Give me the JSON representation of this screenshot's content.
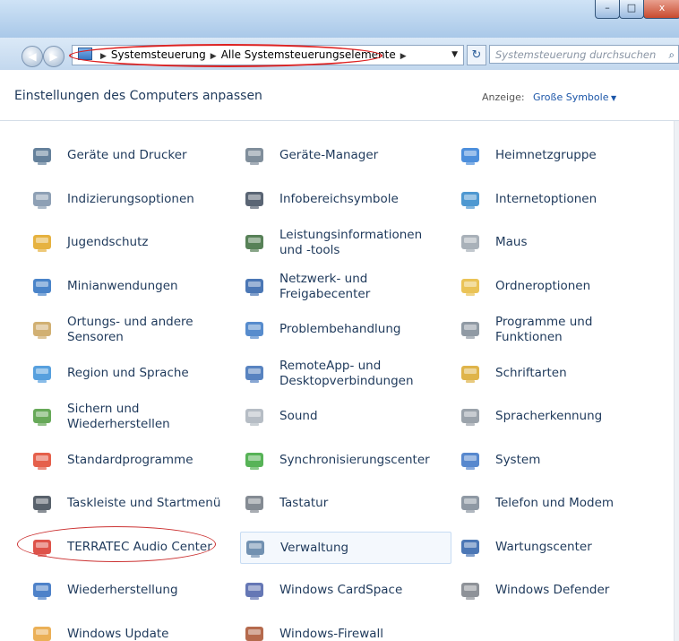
{
  "window": {
    "controls": [
      "–",
      "□",
      "x"
    ]
  },
  "navigation": {
    "back_glyph": "◀",
    "forward_glyph": "▶",
    "breadcrumb": [
      "Systemsteuerung",
      "Alle Systemsteuerungselemente"
    ],
    "separator": "▶",
    "dropdown_glyph": "▼",
    "refresh_glyph": "↻",
    "search_placeholder": "Systemsteuerung durchsuchen",
    "search_glyph": "⌕"
  },
  "header": {
    "title": "Einstellungen des Computers anpassen",
    "view_label": "Anzeige:",
    "view_value": "Große Symbole"
  },
  "items": [
    {
      "label": "Geräte und Drucker",
      "icon": "devices-printers-icon",
      "color": "#4a6b8a"
    },
    {
      "label": "Geräte-Manager",
      "icon": "device-manager-icon",
      "color": "#6a7a8a"
    },
    {
      "label": "Heimnetzgruppe",
      "icon": "homegroup-icon",
      "color": "#2e7bd6"
    },
    {
      "label": "Indizierungsoptionen",
      "icon": "indexing-options-icon",
      "color": "#7a8fa8"
    },
    {
      "label": "Infobereichsymbole",
      "icon": "notification-icons-icon",
      "color": "#3d4a5c"
    },
    {
      "label": "Internetoptionen",
      "icon": "internet-options-icon",
      "color": "#2f86c9"
    },
    {
      "label": "Jugendschutz",
      "icon": "parental-controls-icon",
      "color": "#e2a51f"
    },
    {
      "label": "Leistungsinformationen und -tools",
      "icon": "performance-icon",
      "color": "#3a6b3a"
    },
    {
      "label": "Maus",
      "icon": "mouse-icon",
      "color": "#9aa3ad"
    },
    {
      "label": "Minianwendungen",
      "icon": "gadgets-icon",
      "color": "#2a6fbf"
    },
    {
      "label": "Netzwerk- und Freigabecenter",
      "icon": "network-sharing-icon",
      "color": "#2b5fa8"
    },
    {
      "label": "Ordneroptionen",
      "icon": "folder-options-icon",
      "color": "#e6b93a"
    },
    {
      "label": "Ortungs- und andere Sensoren",
      "icon": "sensors-icon",
      "color": "#c9a25a"
    },
    {
      "label": "Problembehandlung",
      "icon": "troubleshooting-icon",
      "color": "#3a78c4"
    },
    {
      "label": "Programme und Funktionen",
      "icon": "programs-features-icon",
      "color": "#7d8894"
    },
    {
      "label": "Region und Sprache",
      "icon": "region-language-icon",
      "color": "#3a8fd8"
    },
    {
      "label": "RemoteApp- und Desktopverbindungen",
      "icon": "remoteapp-icon",
      "color": "#3b6db5"
    },
    {
      "label": "Schriftarten",
      "icon": "fonts-icon",
      "color": "#d9a72a"
    },
    {
      "label": "Sichern und Wiederherstellen",
      "icon": "backup-restore-icon",
      "color": "#4c9a3c"
    },
    {
      "label": "Sound",
      "icon": "sound-icon",
      "color": "#a9b2bb"
    },
    {
      "label": "Spracherkennung",
      "icon": "speech-recognition-icon",
      "color": "#8a939c"
    },
    {
      "label": "Standardprogramme",
      "icon": "default-programs-icon",
      "color": "#e0442c"
    },
    {
      "label": "Synchronisierungscenter",
      "icon": "sync-center-icon",
      "color": "#3aa63a"
    },
    {
      "label": "System",
      "icon": "system-icon",
      "color": "#3a73c6"
    },
    {
      "label": "Taskleiste und Startmenü",
      "icon": "taskbar-icon",
      "color": "#3c4652"
    },
    {
      "label": "Tastatur",
      "icon": "keyboard-icon",
      "color": "#6f7780"
    },
    {
      "label": "Telefon und Modem",
      "icon": "phone-modem-icon",
      "color": "#7b8794"
    },
    {
      "label": "TERRATEC Audio Center",
      "icon": "terratec-audio-icon",
      "color": "#d8352a"
    },
    {
      "label": "Verwaltung",
      "icon": "administrative-tools-icon",
      "color": "#5b7fa3"
    },
    {
      "label": "Wartungscenter",
      "icon": "action-center-icon",
      "color": "#2d5fa8"
    },
    {
      "label": "Wiederherstellung",
      "icon": "recovery-icon",
      "color": "#2f6cc0"
    },
    {
      "label": "Windows CardSpace",
      "icon": "cardspace-icon",
      "color": "#4a5fa8"
    },
    {
      "label": "Windows Defender",
      "icon": "windows-defender-icon",
      "color": "#7a7f86"
    },
    {
      "label": "Windows Update",
      "icon": "windows-update-icon",
      "color": "#e8a23a"
    },
    {
      "label": "Windows-Firewall",
      "icon": "windows-firewall-icon",
      "color": "#a8502e"
    }
  ]
}
